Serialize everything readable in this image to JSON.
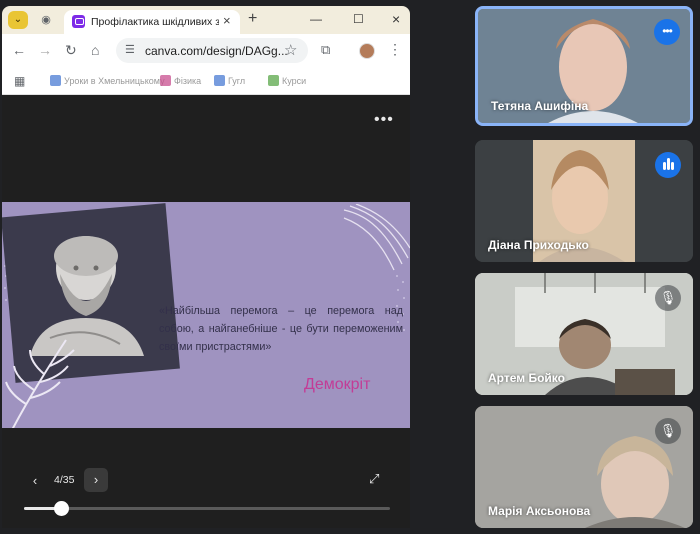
{
  "browser": {
    "tab_title": "Профілактика шкідливих звич",
    "url": "canva.com/design/DAGg...",
    "bookmarks": [
      "Уроки в Хмельницькому",
      "Фізика",
      "Гугл",
      "Курси"
    ]
  },
  "presentation": {
    "quote": "«Найбільша перемога – це перемога над собою, а найганебніше - це бути переможеним своїми пристрастями»",
    "author": "Демокріт",
    "page_indicator": "4/35",
    "progress_fraction": 0.1
  },
  "participants": [
    {
      "name": "Тетяна Ашифіна",
      "status": "more-options-icon"
    },
    {
      "name": "Діана Приходько",
      "status": "speaking-icon"
    },
    {
      "name": "Артем Бойко",
      "status": "mic-off-icon"
    },
    {
      "name": "Марія Аксьонова",
      "status": "mic-off-icon"
    }
  ],
  "colors": {
    "slide_background": "#9f93c0",
    "author_color": "#c33c96",
    "active_speaker_border": "#8ab4f8",
    "badge_blue": "#1a73e8"
  }
}
